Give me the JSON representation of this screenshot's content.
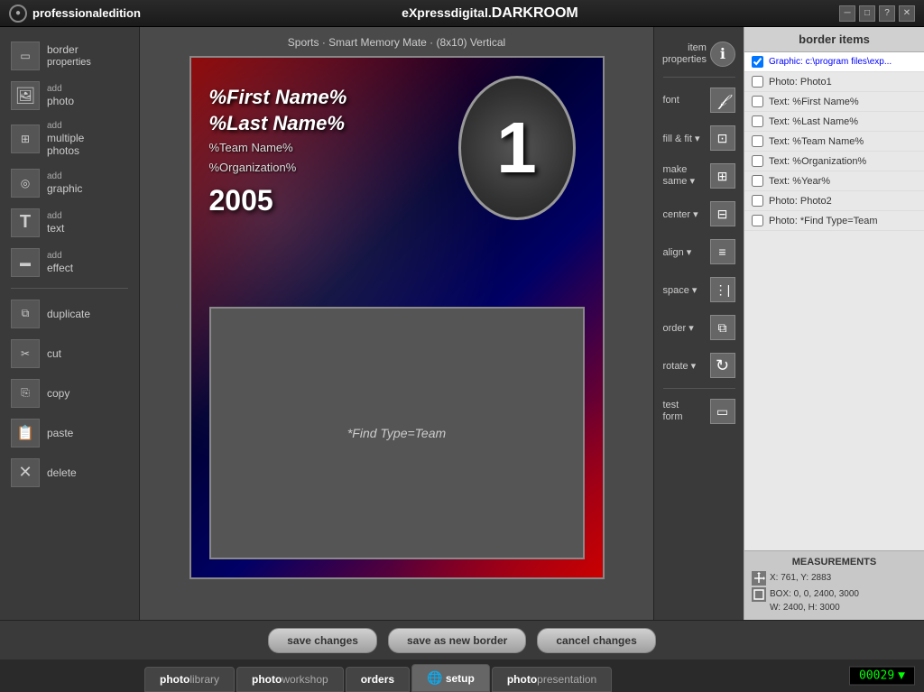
{
  "titlebar": {
    "logo": "●",
    "brand_pre": "professional",
    "brand_main": "edition",
    "app_name": "eXpressdigital.",
    "app_product": "DARKROOM",
    "controls": [
      "─",
      "□",
      "?",
      "✕"
    ]
  },
  "canvas": {
    "title": "Sports · Smart Memory Mate · (8x10) Vertical",
    "card": {
      "name_line1": "%First Name%",
      "name_line2": "%Last Name%",
      "team": "%Team Name%",
      "org": "%Organization%",
      "year": "2005",
      "number": "1",
      "photo_label": "*Find Type=Team"
    }
  },
  "left_sidebar": {
    "items": [
      {
        "id": "border-properties",
        "label": "border",
        "sub": "properties",
        "icon": "▭"
      },
      {
        "id": "add-photo",
        "label": "add",
        "sub": "photo",
        "icon": "🖼"
      },
      {
        "id": "add-multiple-photos",
        "label": "add",
        "sub": "multiple\nphotos",
        "icon": "⊞"
      },
      {
        "id": "add-graphic",
        "label": "add",
        "sub": "graphic",
        "icon": "◎"
      },
      {
        "id": "add-text",
        "label": "add",
        "sub": "text",
        "icon": "T"
      },
      {
        "id": "add-effect",
        "label": "add",
        "sub": "effect",
        "icon": "▬"
      },
      {
        "id": "duplicate",
        "label": "duplicate",
        "sub": "",
        "icon": "⧉"
      },
      {
        "id": "cut",
        "label": "cut",
        "sub": "",
        "icon": "✂"
      },
      {
        "id": "copy",
        "label": "copy",
        "sub": "",
        "icon": "⎘"
      },
      {
        "id": "paste",
        "label": "paste",
        "sub": "",
        "icon": "📋"
      },
      {
        "id": "delete",
        "label": "delete",
        "sub": "",
        "icon": "✕"
      }
    ]
  },
  "right_toolbar": {
    "items": [
      {
        "id": "item-properties",
        "label": "item\nproperties",
        "icon": "ℹ"
      },
      {
        "id": "font",
        "label": "font",
        "icon": "𝒻"
      },
      {
        "id": "fill-fit",
        "label": "fill & fit",
        "icon": "⊡"
      },
      {
        "id": "make-same",
        "label": "make\nsame",
        "icon": "⊞"
      },
      {
        "id": "center",
        "label": "center",
        "icon": "⊟"
      },
      {
        "id": "align",
        "label": "align",
        "icon": "≡"
      },
      {
        "id": "space",
        "label": "space",
        "icon": "⊞"
      },
      {
        "id": "order",
        "label": "order",
        "icon": "⧉"
      },
      {
        "id": "rotate",
        "label": "rotate",
        "icon": "↻"
      },
      {
        "id": "test-form",
        "label": "test\nform",
        "icon": "▭"
      }
    ]
  },
  "border_items": {
    "title": "border items",
    "items": [
      {
        "id": "graphic",
        "label": "Graphic: c:\\program files\\exp...",
        "checked": true
      },
      {
        "id": "photo1",
        "label": "Photo: Photo1",
        "checked": false
      },
      {
        "id": "text-firstname",
        "label": "Text: %First Name%",
        "checked": false
      },
      {
        "id": "text-lastname",
        "label": "Text: %Last Name%",
        "checked": false
      },
      {
        "id": "text-teamname",
        "label": "Text: %Team Name%",
        "checked": false
      },
      {
        "id": "text-organization",
        "label": "Text: %Organization%",
        "checked": false
      },
      {
        "id": "text-year",
        "label": "Text: %Year%",
        "checked": false
      },
      {
        "id": "photo2",
        "label": "Photo: Photo2",
        "checked": false
      },
      {
        "id": "photo-findtype",
        "label": "Photo: *Find Type=Team",
        "checked": false
      }
    ]
  },
  "measurements": {
    "title": "MEASUREMENTS",
    "line1": "X: 761, Y: 2883",
    "line2": "BOX: 0, 0, 2400, 3000",
    "line3": "W: 2400, H: 3000"
  },
  "action_buttons": {
    "save_changes": "save changes",
    "save_as_new_border": "save as new border",
    "cancel_changes": "cancel changes"
  },
  "nav_tabs": [
    {
      "id": "photo-library",
      "bold": "photo",
      "normal": "library",
      "active": false
    },
    {
      "id": "photo-workshop",
      "bold": "photo",
      "normal": "workshop",
      "active": false
    },
    {
      "id": "orders",
      "bold": "orders",
      "normal": "",
      "active": false
    },
    {
      "id": "setup",
      "bold": "setup",
      "normal": "",
      "active": true
    },
    {
      "id": "photo-presentation",
      "bold": "photo",
      "normal": "presentation",
      "active": false
    }
  ],
  "counter": {
    "value": "00029",
    "arrow": "▼"
  }
}
